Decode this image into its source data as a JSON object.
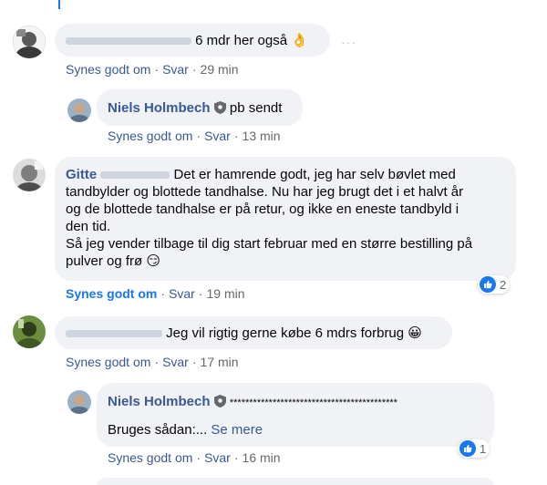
{
  "action_like": "Synes godt om",
  "action_reply": "Svar",
  "separator": "·",
  "comments": [
    {
      "name": "",
      "text": "6 mdr her også",
      "emoji": "👌",
      "time": "29 min",
      "more": "···"
    },
    {
      "name": "Niels Holmbech",
      "text": "pb sendt",
      "time": "13 min"
    },
    {
      "name": "Gitte",
      "text_lines": [
        "Det er hamrende godt, jeg har selv bøvlet med",
        "tandbylder og blottede tandhalse. Nu har jeg brugt det i et halvt år",
        "og de blottede tandhalse er på retur, og ikke en eneste tandbyld i",
        "den tid.",
        "Så jeg vender tilbage til dig start februar med en større bestilling på",
        "pulver og frø"
      ],
      "emoji": "😏",
      "time": "19 min",
      "reaction_count": "2"
    },
    {
      "name": "",
      "text": "Jeg vil rigtig gerne købe 6 mdrs forbrug",
      "emoji": "😀",
      "time": "17 min"
    },
    {
      "name": "Niels Holmbech",
      "stars": "*******************************************",
      "text": "Bruges sådan:...",
      "see_more": "Se mere",
      "time": "16 min",
      "reaction_count": "1"
    }
  ],
  "colors": {
    "link": "#385898",
    "accent": "#1877f2",
    "bubble": "#f0f2f5",
    "meta": "#65676b"
  }
}
